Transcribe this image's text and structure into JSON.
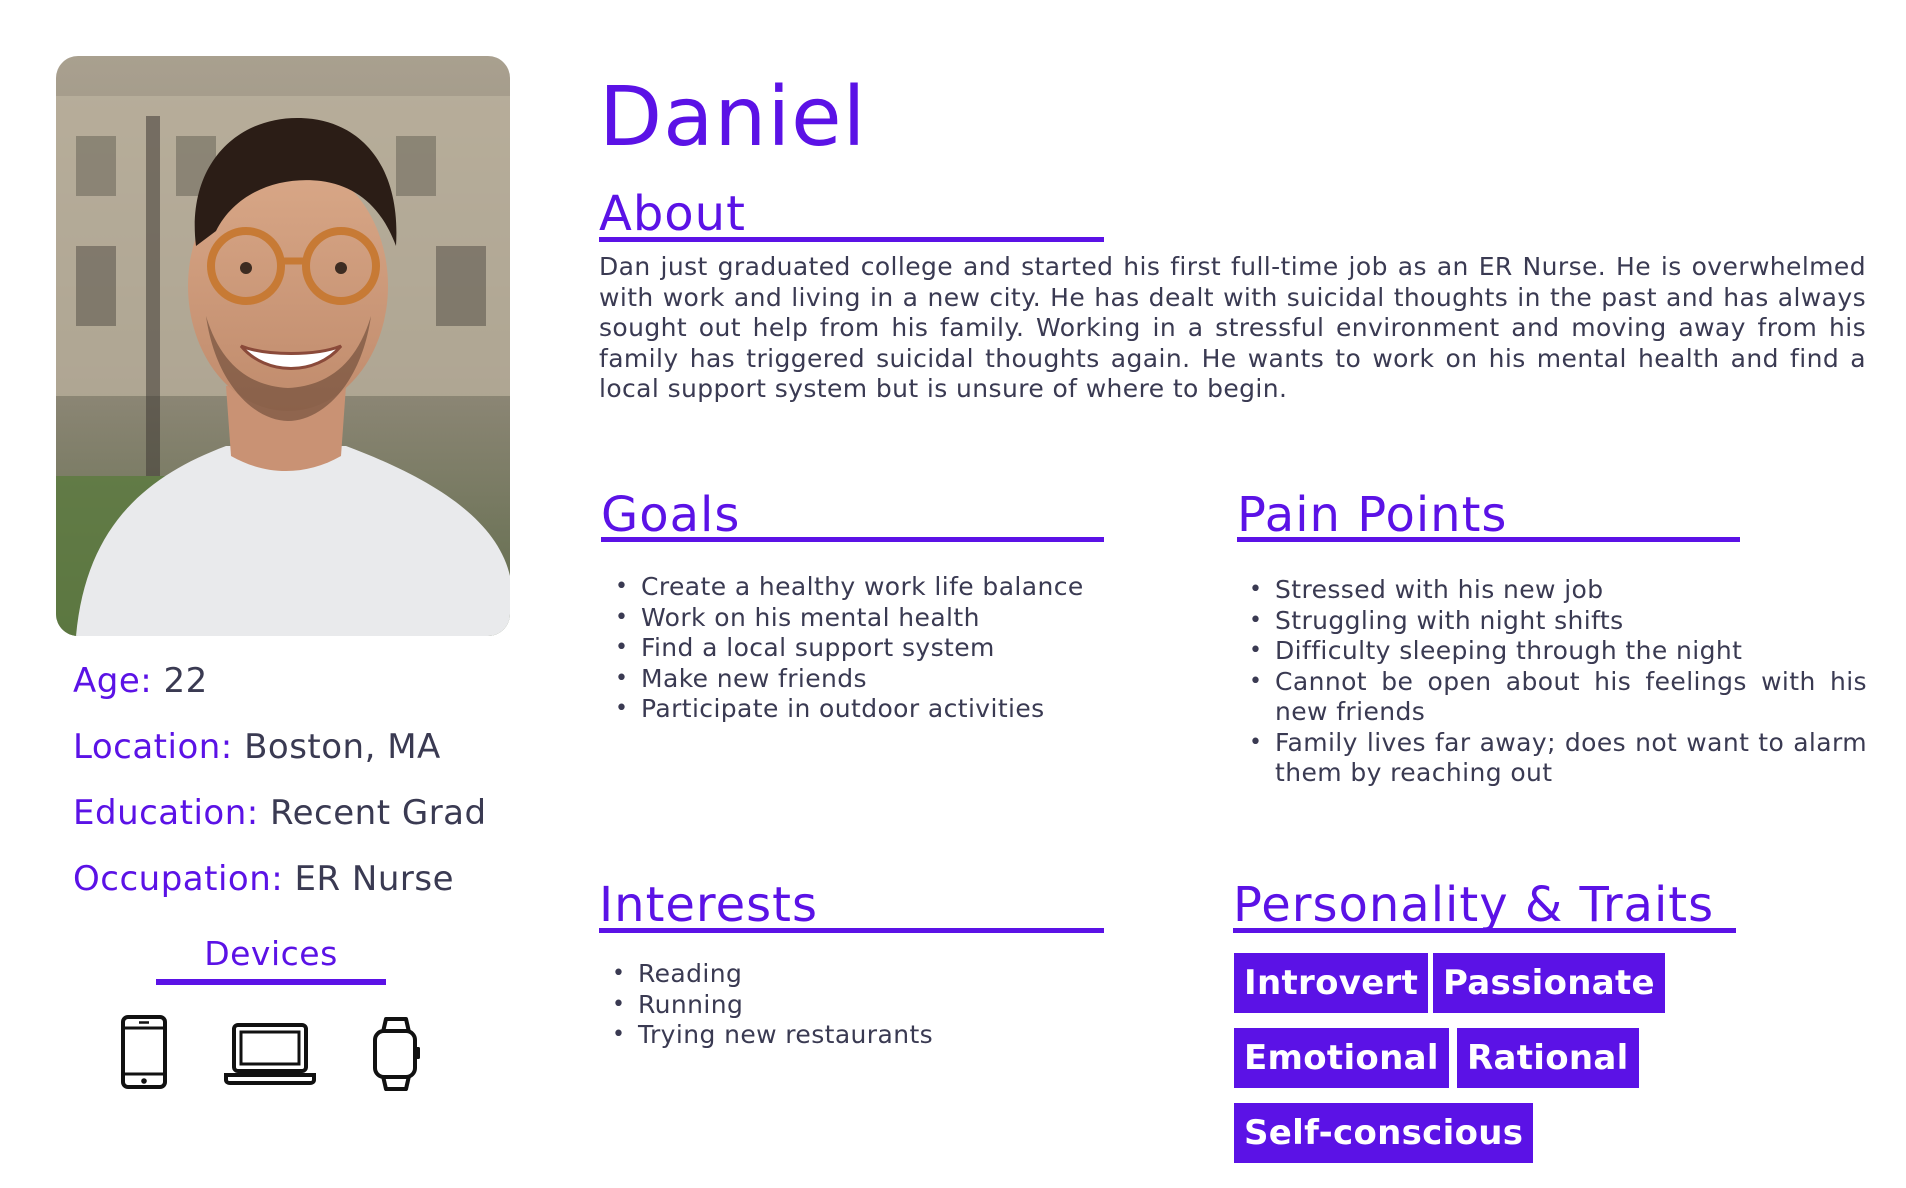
{
  "persona": {
    "name": "Daniel"
  },
  "demographics": [
    {
      "label": "Age:",
      "value": "22"
    },
    {
      "label": "Location:",
      "value": "Boston, MA"
    },
    {
      "label": "Education:",
      "value": "Recent Grad"
    },
    {
      "label": "Occupation:",
      "value": "ER Nurse"
    }
  ],
  "devices": {
    "title": "Devices",
    "icons": [
      "smartphone-icon",
      "laptop-icon",
      "smartwatch-icon"
    ]
  },
  "about": {
    "title": "About",
    "text": "Dan just graduated college and started his first full-time job as an ER Nurse. He is overwhelmed with work and living in a new city. He has dealt with suicidal thoughts in the past and has always sought out help from his family. Working in a stressful environment and moving away from his family has triggered suicidal thoughts again. He wants to work on his mental health and find a local support system but is unsure of where to begin."
  },
  "goals": {
    "title": "Goals",
    "items": [
      "Create a healthy work life balance",
      "Work on his mental health",
      "Find a local support system",
      "Make new friends",
      "Participate in outdoor activities"
    ]
  },
  "pain_points": {
    "title": "Pain Points",
    "items": [
      "Stressed with his new job",
      "Struggling with night shifts",
      "Difficulty sleeping through the night",
      "Cannot be open about his feelings with his new friends",
      "Family lives far away; does not want to alarm them by reaching out"
    ]
  },
  "interests": {
    "title": "Interests",
    "items": [
      "Reading",
      "Running",
      "Trying new restaurants"
    ]
  },
  "personality": {
    "title": "Personality & Traits",
    "traits": [
      "Introvert",
      "Passionate",
      "Emotional",
      "Rational",
      "Self-conscious"
    ]
  },
  "colors": {
    "accent": "#5b12e6",
    "text": "#3a3a52",
    "background": "#ffffff"
  }
}
